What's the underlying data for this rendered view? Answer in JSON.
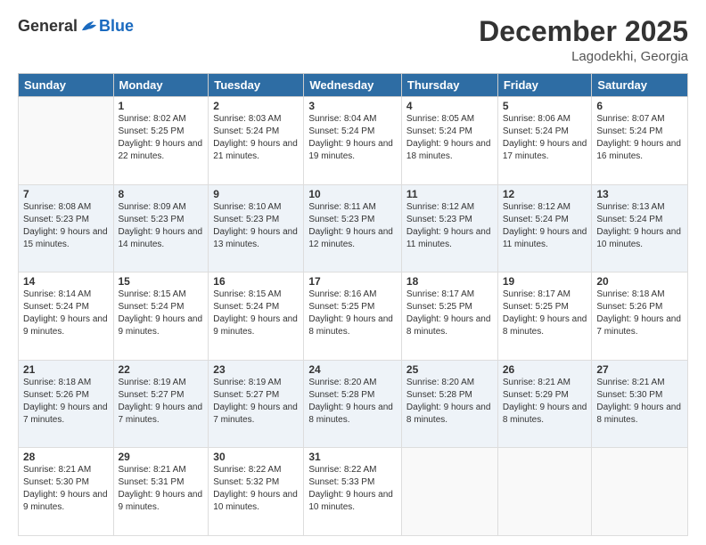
{
  "header": {
    "logo_general": "General",
    "logo_blue": "Blue",
    "month_title": "December 2025",
    "location": "Lagodekhi, Georgia"
  },
  "weekdays": [
    "Sunday",
    "Monday",
    "Tuesday",
    "Wednesday",
    "Thursday",
    "Friday",
    "Saturday"
  ],
  "weeks": [
    [
      {
        "day": "",
        "sunrise": "",
        "sunset": "",
        "daylight": ""
      },
      {
        "day": "1",
        "sunrise": "Sunrise: 8:02 AM",
        "sunset": "Sunset: 5:25 PM",
        "daylight": "Daylight: 9 hours and 22 minutes."
      },
      {
        "day": "2",
        "sunrise": "Sunrise: 8:03 AM",
        "sunset": "Sunset: 5:24 PM",
        "daylight": "Daylight: 9 hours and 21 minutes."
      },
      {
        "day": "3",
        "sunrise": "Sunrise: 8:04 AM",
        "sunset": "Sunset: 5:24 PM",
        "daylight": "Daylight: 9 hours and 19 minutes."
      },
      {
        "day": "4",
        "sunrise": "Sunrise: 8:05 AM",
        "sunset": "Sunset: 5:24 PM",
        "daylight": "Daylight: 9 hours and 18 minutes."
      },
      {
        "day": "5",
        "sunrise": "Sunrise: 8:06 AM",
        "sunset": "Sunset: 5:24 PM",
        "daylight": "Daylight: 9 hours and 17 minutes."
      },
      {
        "day": "6",
        "sunrise": "Sunrise: 8:07 AM",
        "sunset": "Sunset: 5:24 PM",
        "daylight": "Daylight: 9 hours and 16 minutes."
      }
    ],
    [
      {
        "day": "7",
        "sunrise": "Sunrise: 8:08 AM",
        "sunset": "Sunset: 5:23 PM",
        "daylight": "Daylight: 9 hours and 15 minutes."
      },
      {
        "day": "8",
        "sunrise": "Sunrise: 8:09 AM",
        "sunset": "Sunset: 5:23 PM",
        "daylight": "Daylight: 9 hours and 14 minutes."
      },
      {
        "day": "9",
        "sunrise": "Sunrise: 8:10 AM",
        "sunset": "Sunset: 5:23 PM",
        "daylight": "Daylight: 9 hours and 13 minutes."
      },
      {
        "day": "10",
        "sunrise": "Sunrise: 8:11 AM",
        "sunset": "Sunset: 5:23 PM",
        "daylight": "Daylight: 9 hours and 12 minutes."
      },
      {
        "day": "11",
        "sunrise": "Sunrise: 8:12 AM",
        "sunset": "Sunset: 5:23 PM",
        "daylight": "Daylight: 9 hours and 11 minutes."
      },
      {
        "day": "12",
        "sunrise": "Sunrise: 8:12 AM",
        "sunset": "Sunset: 5:24 PM",
        "daylight": "Daylight: 9 hours and 11 minutes."
      },
      {
        "day": "13",
        "sunrise": "Sunrise: 8:13 AM",
        "sunset": "Sunset: 5:24 PM",
        "daylight": "Daylight: 9 hours and 10 minutes."
      }
    ],
    [
      {
        "day": "14",
        "sunrise": "Sunrise: 8:14 AM",
        "sunset": "Sunset: 5:24 PM",
        "daylight": "Daylight: 9 hours and 9 minutes."
      },
      {
        "day": "15",
        "sunrise": "Sunrise: 8:15 AM",
        "sunset": "Sunset: 5:24 PM",
        "daylight": "Daylight: 9 hours and 9 minutes."
      },
      {
        "day": "16",
        "sunrise": "Sunrise: 8:15 AM",
        "sunset": "Sunset: 5:24 PM",
        "daylight": "Daylight: 9 hours and 9 minutes."
      },
      {
        "day": "17",
        "sunrise": "Sunrise: 8:16 AM",
        "sunset": "Sunset: 5:25 PM",
        "daylight": "Daylight: 9 hours and 8 minutes."
      },
      {
        "day": "18",
        "sunrise": "Sunrise: 8:17 AM",
        "sunset": "Sunset: 5:25 PM",
        "daylight": "Daylight: 9 hours and 8 minutes."
      },
      {
        "day": "19",
        "sunrise": "Sunrise: 8:17 AM",
        "sunset": "Sunset: 5:25 PM",
        "daylight": "Daylight: 9 hours and 8 minutes."
      },
      {
        "day": "20",
        "sunrise": "Sunrise: 8:18 AM",
        "sunset": "Sunset: 5:26 PM",
        "daylight": "Daylight: 9 hours and 7 minutes."
      }
    ],
    [
      {
        "day": "21",
        "sunrise": "Sunrise: 8:18 AM",
        "sunset": "Sunset: 5:26 PM",
        "daylight": "Daylight: 9 hours and 7 minutes."
      },
      {
        "day": "22",
        "sunrise": "Sunrise: 8:19 AM",
        "sunset": "Sunset: 5:27 PM",
        "daylight": "Daylight: 9 hours and 7 minutes."
      },
      {
        "day": "23",
        "sunrise": "Sunrise: 8:19 AM",
        "sunset": "Sunset: 5:27 PM",
        "daylight": "Daylight: 9 hours and 7 minutes."
      },
      {
        "day": "24",
        "sunrise": "Sunrise: 8:20 AM",
        "sunset": "Sunset: 5:28 PM",
        "daylight": "Daylight: 9 hours and 8 minutes."
      },
      {
        "day": "25",
        "sunrise": "Sunrise: 8:20 AM",
        "sunset": "Sunset: 5:28 PM",
        "daylight": "Daylight: 9 hours and 8 minutes."
      },
      {
        "day": "26",
        "sunrise": "Sunrise: 8:21 AM",
        "sunset": "Sunset: 5:29 PM",
        "daylight": "Daylight: 9 hours and 8 minutes."
      },
      {
        "day": "27",
        "sunrise": "Sunrise: 8:21 AM",
        "sunset": "Sunset: 5:30 PM",
        "daylight": "Daylight: 9 hours and 8 minutes."
      }
    ],
    [
      {
        "day": "28",
        "sunrise": "Sunrise: 8:21 AM",
        "sunset": "Sunset: 5:30 PM",
        "daylight": "Daylight: 9 hours and 9 minutes."
      },
      {
        "day": "29",
        "sunrise": "Sunrise: 8:21 AM",
        "sunset": "Sunset: 5:31 PM",
        "daylight": "Daylight: 9 hours and 9 minutes."
      },
      {
        "day": "30",
        "sunrise": "Sunrise: 8:22 AM",
        "sunset": "Sunset: 5:32 PM",
        "daylight": "Daylight: 9 hours and 10 minutes."
      },
      {
        "day": "31",
        "sunrise": "Sunrise: 8:22 AM",
        "sunset": "Sunset: 5:33 PM",
        "daylight": "Daylight: 9 hours and 10 minutes."
      },
      {
        "day": "",
        "sunrise": "",
        "sunset": "",
        "daylight": ""
      },
      {
        "day": "",
        "sunrise": "",
        "sunset": "",
        "daylight": ""
      },
      {
        "day": "",
        "sunrise": "",
        "sunset": "",
        "daylight": ""
      }
    ]
  ]
}
